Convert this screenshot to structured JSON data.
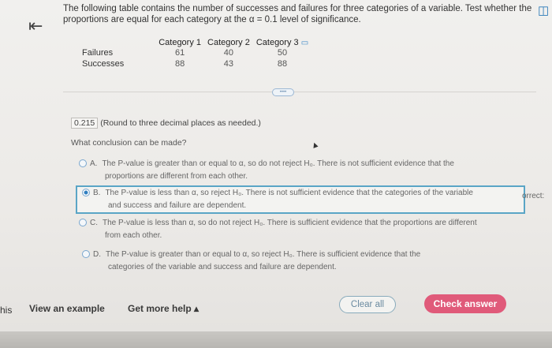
{
  "question": {
    "line1": "The following table contains the number of successes and failures for three categories of a variable. Test whether the",
    "line2": "proportions are equal for each category at the α = 0.1 level of significance."
  },
  "table": {
    "headers": [
      "",
      "Category 1",
      "Category 2",
      "Category 3"
    ],
    "rows": [
      {
        "label": "Failures",
        "values": [
          "61",
          "40",
          "50"
        ]
      },
      {
        "label": "Successes",
        "values": [
          "88",
          "43",
          "88"
        ]
      }
    ]
  },
  "answer": {
    "value": "0.215",
    "note": "(Round to three decimal places as needed.)"
  },
  "prompt": "What conclusion can be made?",
  "options": [
    {
      "letter": "A.",
      "line1": "The P-value is greater than or equal to α, so do not reject H₀. There is not sufficient evidence that the",
      "line2": "proportions are different from each other.",
      "selected": false
    },
    {
      "letter": "B.",
      "line1": "The P-value is less than α, so reject H₀. There is not sufficient evidence that the categories of the variable",
      "line2": "and success and failure are dependent.",
      "selected": true
    },
    {
      "letter": "C.",
      "line1": "The P-value is less than α, so do not reject H₀. There is sufficient evidence that the proportions are different",
      "line2": "from each other.",
      "selected": false
    },
    {
      "letter": "D.",
      "line1": "The P-value is greater than or equal to α, so reject H₀. There is sufficient evidence that the",
      "line2": "categories of the variable and success and failure are dependent.",
      "selected": false
    }
  ],
  "correct_tag": "orrect:",
  "left_clip": "his",
  "links": {
    "example": "View an example",
    "help": "Get more help ▴"
  },
  "buttons": {
    "clear": "Clear all",
    "check": "Check answer"
  },
  "icons": {
    "back": "back-arrow-icon",
    "copy": "copy-icon",
    "expand": "more-dots-icon",
    "cursor": "mouse-cursor-icon"
  },
  "colors": {
    "accent": "#2f7fc0",
    "check_button": "#e05a7a",
    "selected_border": "#5aa5c6"
  }
}
